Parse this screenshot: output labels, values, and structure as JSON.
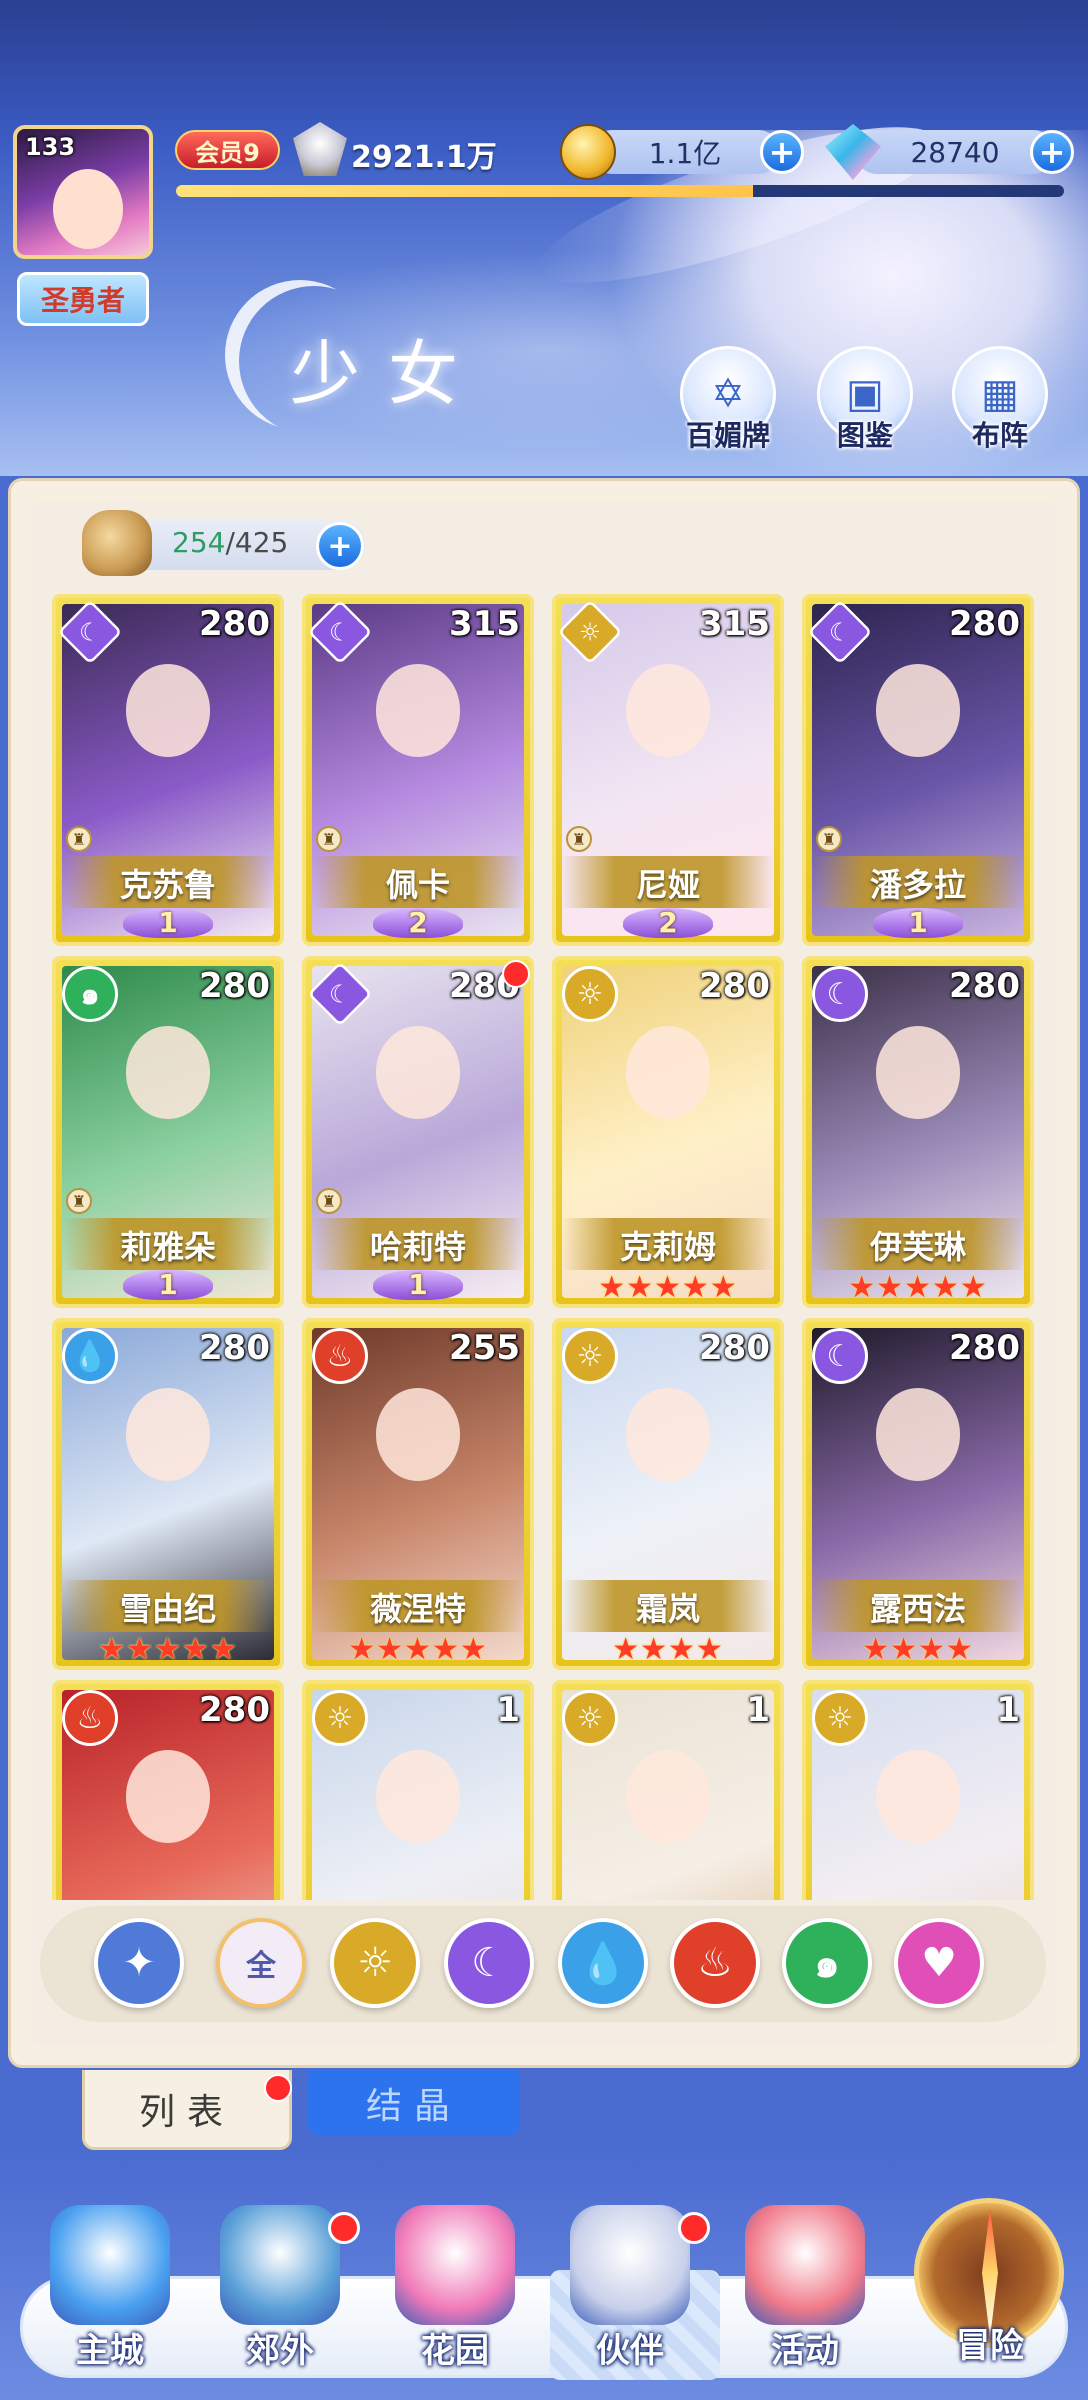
{
  "header": {
    "avatar_level": "133",
    "title_badge": "圣勇者",
    "vip_label": "会员9",
    "power": "2921.1万",
    "gold": "1.1亿",
    "gems": "28740",
    "xp_fraction": 0.65,
    "page_title": "少女",
    "buttons": [
      {
        "label": "百媚牌",
        "icon": "card-book-icon"
      },
      {
        "label": "图鉴",
        "icon": "codex-book-icon"
      },
      {
        "label": "布阵",
        "icon": "formation-grid-icon"
      }
    ]
  },
  "roster": {
    "current": "254",
    "max": "425",
    "separator": "/",
    "plus": "+"
  },
  "element_colors": {
    "moon": "#8a57e0",
    "light": "#d9a928",
    "water": "#3aa0e8",
    "fire": "#e0402a",
    "wind": "#2fb05a",
    "heart": "#e04fb8",
    "star": "#4f7ad8"
  },
  "cards": [
    {
      "name": "克苏鲁",
      "num": "280",
      "element": "moon",
      "shape": "diamond",
      "rank": "1",
      "stars": "",
      "dot": false,
      "chess": true,
      "art": [
        "#3b2a55",
        "#8a5bc8",
        "#f3e7f4"
      ]
    },
    {
      "name": "佩卡",
      "num": "315",
      "element": "moon",
      "shape": "diamond",
      "rank": "2",
      "stars": "",
      "dot": false,
      "chess": true,
      "art": [
        "#5b3a86",
        "#b58ae0",
        "#e9e3ef"
      ]
    },
    {
      "name": "尼娅",
      "num": "315",
      "element": "light",
      "shape": "diamond",
      "rank": "2",
      "stars": "",
      "dot": false,
      "chess": true,
      "art": [
        "#d5c9ea",
        "#f3e6f3",
        "#ffe6ee"
      ]
    },
    {
      "name": "潘多拉",
      "num": "280",
      "element": "moon",
      "shape": "diamond",
      "rank": "1",
      "stars": "",
      "dot": false,
      "chess": true,
      "art": [
        "#2d244f",
        "#6a56a8",
        "#c9b4e0"
      ]
    },
    {
      "name": "莉雅朵",
      "num": "280",
      "element": "wind",
      "shape": "circle",
      "rank": "1",
      "stars": "",
      "dot": false,
      "chess": true,
      "art": [
        "#2e8a4a",
        "#8ad0a0",
        "#f0e6d8"
      ]
    },
    {
      "name": "哈莉特",
      "num": "280",
      "element": "moon",
      "shape": "diamond",
      "rank": "1",
      "stars": "",
      "dot": true,
      "chess": true,
      "art": [
        "#e8e3ee",
        "#b9a8d9",
        "#f6edf2"
      ]
    },
    {
      "name": "克莉姆",
      "num": "280",
      "element": "light",
      "shape": "circle",
      "rank": "",
      "stars": "★★★★★",
      "dot": false,
      "chess": false,
      "art": [
        "#f0d27a",
        "#fff0c8",
        "#f6dcc8"
      ]
    },
    {
      "name": "伊芙琳",
      "num": "280",
      "element": "moon",
      "shape": "circle",
      "rank": "",
      "stars": "★★★★★",
      "dot": false,
      "chess": false,
      "art": [
        "#3c3048",
        "#9a8ab8",
        "#eee6f0"
      ]
    },
    {
      "name": "雪由纪",
      "num": "280",
      "element": "water",
      "shape": "circle",
      "rank": "",
      "stars": "★★★★★",
      "dot": false,
      "chess": false,
      "art": [
        "#8aa8d8",
        "#dfe8f5",
        "#2b2b35"
      ]
    },
    {
      "name": "薇涅特",
      "num": "255",
      "element": "fire",
      "shape": "circle",
      "rank": "",
      "stars": "★★★★★",
      "dot": false,
      "chess": false,
      "art": [
        "#6e3a2a",
        "#c8866a",
        "#f3d9cc"
      ]
    },
    {
      "name": "霜岚",
      "num": "280",
      "element": "light",
      "shape": "circle",
      "rank": "",
      "stars": "★★★★",
      "dot": false,
      "chess": false,
      "art": [
        "#c9d8f0",
        "#eef2f8",
        "#f3e8e8"
      ]
    },
    {
      "name": "露西法",
      "num": "280",
      "element": "moon",
      "shape": "circle",
      "rank": "",
      "stars": "★★★★",
      "dot": false,
      "chess": false,
      "art": [
        "#1f1a2a",
        "#8a6aa8",
        "#f0d8e0"
      ]
    },
    {
      "name": "",
      "num": "280",
      "element": "fire",
      "shape": "circle",
      "rank": "",
      "stars": "",
      "dot": false,
      "chess": false,
      "art": [
        "#b8222a",
        "#e86a5a",
        "#f3d2c8"
      ]
    },
    {
      "name": "",
      "num": "1",
      "element": "light",
      "shape": "circle",
      "rank": "",
      "stars": "",
      "dot": false,
      "chess": false,
      "art": [
        "#c8d6ea",
        "#eef0f6",
        "#e8dcd4"
      ]
    },
    {
      "name": "",
      "num": "1",
      "element": "light",
      "shape": "circle",
      "rank": "",
      "stars": "",
      "dot": false,
      "chess": false,
      "art": [
        "#e9e2d4",
        "#f6efe6",
        "#d4b08a"
      ]
    },
    {
      "name": "",
      "num": "1",
      "element": "light",
      "shape": "circle",
      "rank": "",
      "stars": "",
      "dot": false,
      "chess": false,
      "art": [
        "#d6def0",
        "#f3eef2",
        "#e6d4c8"
      ]
    }
  ],
  "filters": [
    {
      "name": "filter-star",
      "label": "✦",
      "color": "#4f7ad8"
    },
    {
      "name": "filter-all",
      "label": "全",
      "color": "#f3ecf7"
    },
    {
      "name": "filter-light",
      "label": "☼",
      "color": "#d9a928"
    },
    {
      "name": "filter-moon",
      "label": "☾",
      "color": "#8a57e0"
    },
    {
      "name": "filter-water",
      "label": "💧",
      "color": "#3aa0e8"
    },
    {
      "name": "filter-fire",
      "label": "♨",
      "color": "#e0402a"
    },
    {
      "name": "filter-wind",
      "label": "๑",
      "color": "#2fb05a"
    },
    {
      "name": "filter-heart",
      "label": "♥",
      "color": "#e04fb8"
    }
  ],
  "tabs": {
    "list": "列表",
    "crystal": "结晶"
  },
  "nav": [
    {
      "label": "主城",
      "icon": "castle-icon",
      "color": "#4aa0f0",
      "dot": false
    },
    {
      "label": "郊外",
      "icon": "portal-icon",
      "color": "#5aa0d8",
      "dot": true
    },
    {
      "label": "花园",
      "icon": "heart-garden-icon",
      "color": "#f07ab8",
      "dot": false
    },
    {
      "label": "伙伴",
      "icon": "partner-icon",
      "color": "#c8d0ea",
      "dot": true
    },
    {
      "label": "活动",
      "icon": "gift-box-icon",
      "color": "#f07a8a",
      "dot": false
    }
  ],
  "adventure_label": "冒险"
}
